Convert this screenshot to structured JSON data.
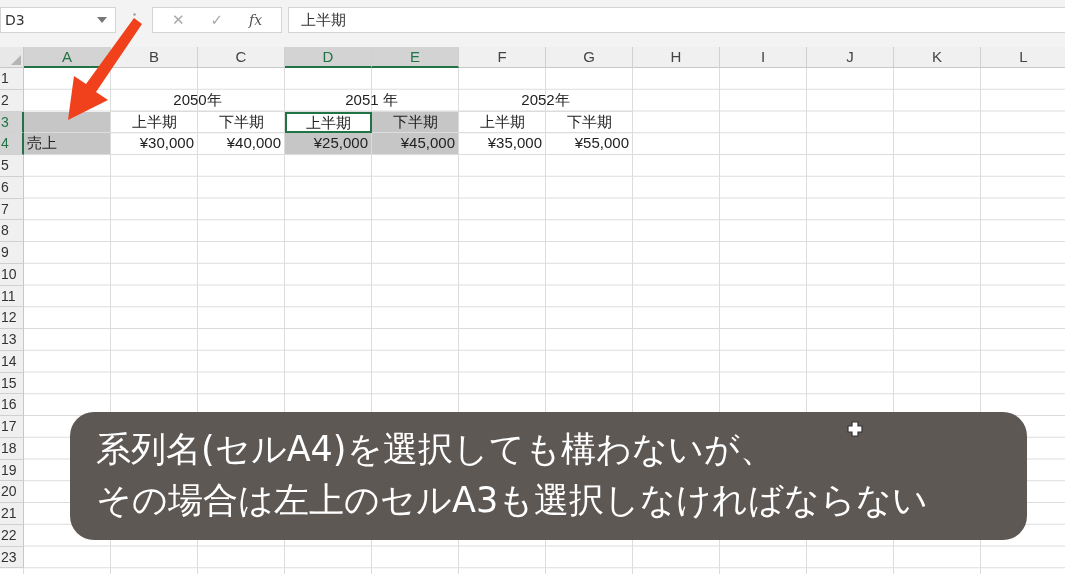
{
  "formula_bar": {
    "name_box": "D3",
    "cancel": "✕",
    "enter": "✓",
    "function": "fx",
    "formula": "上半期"
  },
  "columns": [
    {
      "label": "A",
      "selected": true
    },
    {
      "label": "B",
      "selected": false
    },
    {
      "label": "C",
      "selected": false
    },
    {
      "label": "D",
      "selected": true
    },
    {
      "label": "E",
      "selected": true
    },
    {
      "label": "F",
      "selected": false
    },
    {
      "label": "G",
      "selected": false
    },
    {
      "label": "H",
      "selected": false
    },
    {
      "label": "I",
      "selected": false
    },
    {
      "label": "J",
      "selected": false
    },
    {
      "label": "K",
      "selected": false
    },
    {
      "label": "L",
      "selected": false
    }
  ],
  "rows": [
    {
      "label": "1",
      "selected": false,
      "cells": []
    },
    {
      "label": "2",
      "selected": false,
      "cells": [
        {
          "selected": false
        },
        {
          "text": "2050年",
          "kind": "group-heading",
          "selected": false
        },
        {
          "text": "2051 年",
          "kind": "group-heading",
          "selected": false
        },
        {
          "text": "2052年",
          "kind": "group-heading",
          "selected": false
        }
      ]
    },
    {
      "label": "3",
      "selected": true,
      "cells": [
        {
          "selected": true
        },
        {
          "text": "上半期",
          "kind": "heading",
          "selected": false
        },
        {
          "text": "下半期",
          "kind": "heading",
          "selected": false
        },
        {
          "text": "上半期",
          "kind": "heading",
          "selected": true,
          "active": true
        },
        {
          "text": "下半期",
          "kind": "heading",
          "selected": true
        },
        {
          "text": "上半期",
          "kind": "heading",
          "selected": false
        },
        {
          "text": "下半期",
          "kind": "heading",
          "selected": false
        }
      ]
    },
    {
      "label": "4",
      "selected": true,
      "cells": [
        {
          "text": "売上",
          "kind": "text",
          "selected": true
        },
        {
          "text": "¥30,000",
          "kind": "currency",
          "selected": false
        },
        {
          "text": "¥40,000",
          "kind": "currency",
          "selected": false
        },
        {
          "text": "¥25,000",
          "kind": "currency",
          "selected": true
        },
        {
          "text": "¥45,000",
          "kind": "currency",
          "selected": true
        },
        {
          "text": "¥35,000",
          "kind": "currency",
          "selected": false
        },
        {
          "text": "¥55,000",
          "kind": "currency",
          "selected": false
        }
      ]
    },
    {
      "label": "5",
      "selected": false,
      "cells": []
    },
    {
      "label": "6",
      "selected": false,
      "cells": []
    },
    {
      "label": "7",
      "selected": false,
      "cells": []
    },
    {
      "label": "8",
      "selected": false,
      "cells": []
    },
    {
      "label": "9",
      "selected": false,
      "cells": []
    },
    {
      "label": "10",
      "selected": false,
      "cells": []
    },
    {
      "label": "11",
      "selected": false,
      "cells": []
    },
    {
      "label": "12",
      "selected": false,
      "cells": []
    },
    {
      "label": "13",
      "selected": false,
      "cells": []
    },
    {
      "label": "14",
      "selected": false,
      "cells": []
    },
    {
      "label": "15",
      "selected": false,
      "cells": []
    },
    {
      "label": "16",
      "selected": false,
      "cells": []
    },
    {
      "label": "17",
      "selected": false,
      "cells": []
    },
    {
      "label": "18",
      "selected": false,
      "cells": []
    },
    {
      "label": "19",
      "selected": false,
      "cells": []
    },
    {
      "label": "20",
      "selected": false,
      "cells": []
    },
    {
      "label": "21",
      "selected": false,
      "cells": []
    },
    {
      "label": "22",
      "selected": false,
      "cells": []
    },
    {
      "label": "23",
      "selected": false,
      "cells": []
    }
  ],
  "caption": [
    "系列名(セルA4)を選択しても構わないが、",
    "その場合は左上のセルA3も選択しなければならない"
  ]
}
